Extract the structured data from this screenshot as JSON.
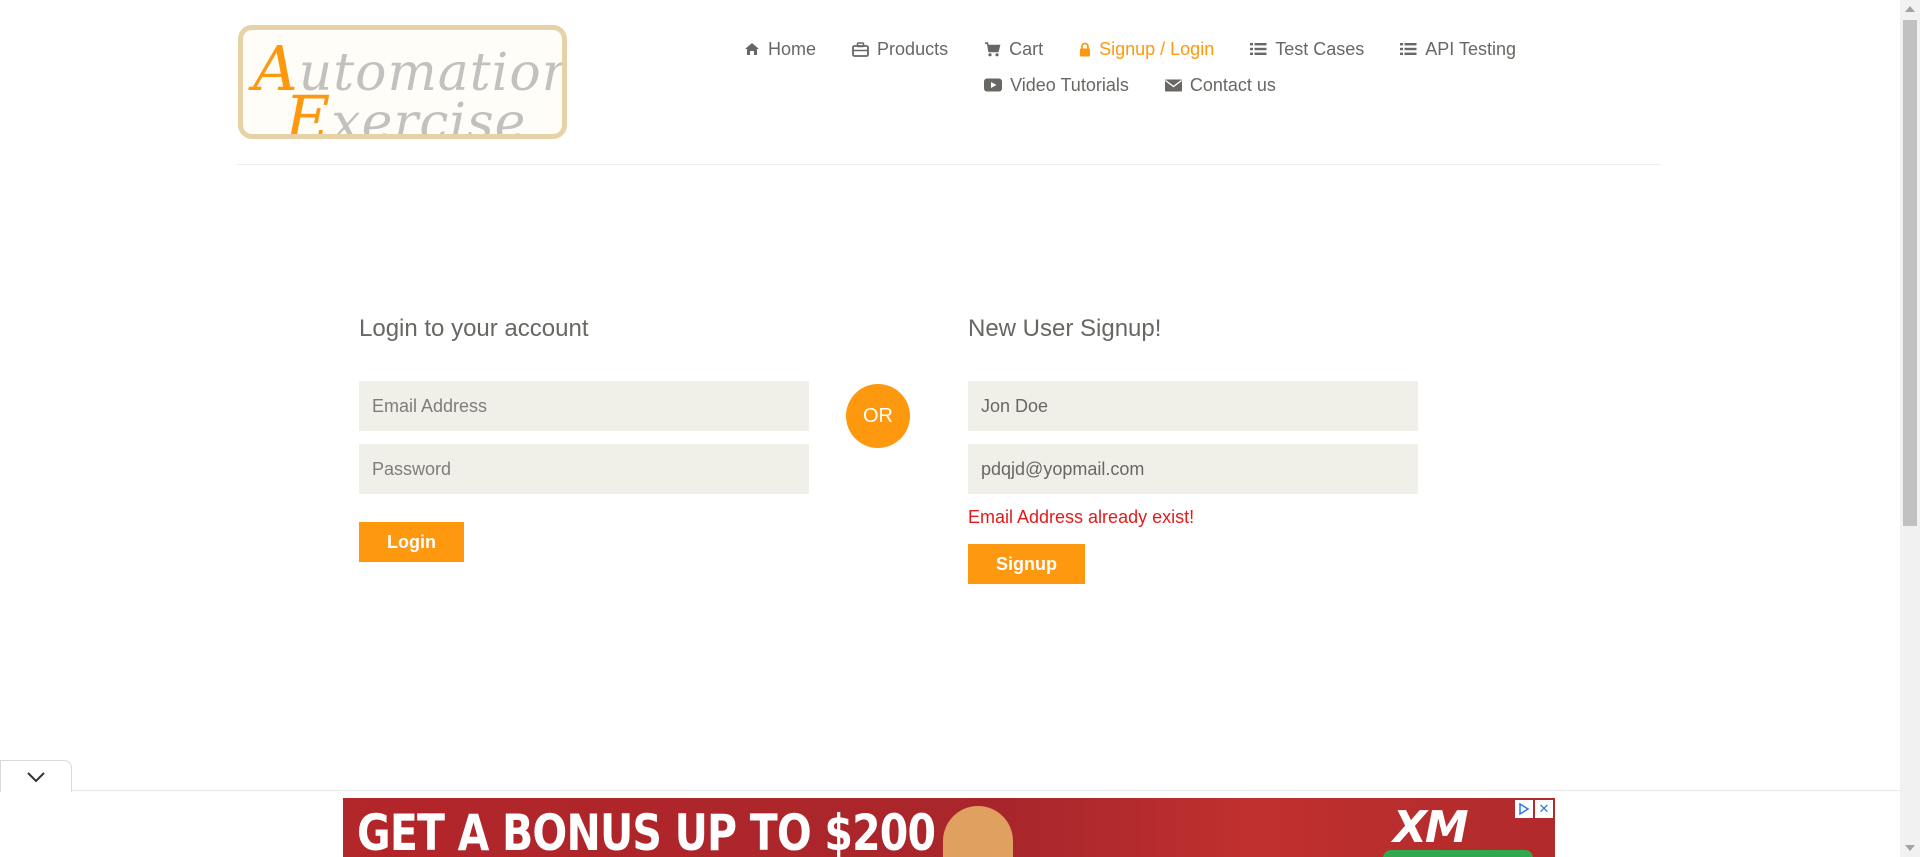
{
  "logo": {
    "line1_cap": "A",
    "line1_rest": "utomation",
    "line2_cap": "E",
    "line2_rest": "xercise"
  },
  "nav": {
    "row1": [
      {
        "label": "Home",
        "icon": "home-icon",
        "active": false
      },
      {
        "label": "Products",
        "icon": "briefcase-icon",
        "active": false
      },
      {
        "label": "Cart",
        "icon": "cart-icon",
        "active": false
      },
      {
        "label": "Signup / Login",
        "icon": "lock-icon",
        "active": true
      },
      {
        "label": "Test Cases",
        "icon": "list-icon",
        "active": false
      },
      {
        "label": "API Testing",
        "icon": "list-icon",
        "active": false
      }
    ],
    "row2": [
      {
        "label": "Video Tutorials",
        "icon": "youtube-play-icon",
        "active": false
      },
      {
        "label": "Contact us",
        "icon": "envelope-icon",
        "active": false
      }
    ]
  },
  "login": {
    "title": "Login to your account",
    "email_placeholder": "Email Address",
    "password_placeholder": "Password",
    "button": "Login"
  },
  "or_label": "OR",
  "signup": {
    "title": "New User Signup!",
    "name_value": "Jon Doe",
    "email_value": "pdqjd@yopmail.com",
    "error": "Email Address already exist!",
    "button": "Signup"
  },
  "ad": {
    "headline": "GET A BONUS UP TO $200",
    "brand": "XM",
    "adchoices_icon": "adchoices-icon",
    "close": "✕"
  },
  "colors": {
    "accent": "#fe980f",
    "error": "#e41a1a",
    "field_bg": "#f0f0e9",
    "text": "#696763"
  }
}
